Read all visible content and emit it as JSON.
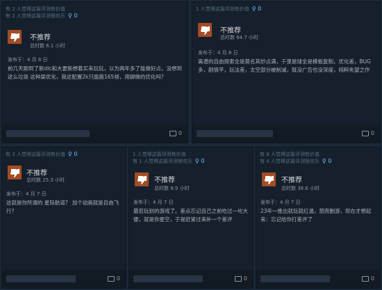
{
  "reviews": [
    {
      "helpful_line1": "有 2 人觉得这篇评测有价值",
      "helpful_line2": "有 2 人觉得这篇评测很欢乐",
      "award_count": "0",
      "verdict": "不推荐",
      "hours": "总时数 6.1 小时",
      "date": "发布于：4 月 8 日",
      "text": "前几天刚到了新dlc和大更新想着买来玩玩，以为两年多了能做好点，没想到这么垃圾 这种屎优化，我这配置2k只能跑165帧，用脚做的优化吗？",
      "comments": "0"
    },
    {
      "helpful_line1": "1 人觉得这篇评测有价值",
      "helpful_line2": "",
      "award_count": "0",
      "verdict": "不推荐",
      "hours": "总时数 64.7 小时",
      "date": "发布于：4 月 8 日",
      "text": "离谱的自由探索全是莫名其妙点满，千里是球全是模板复制，优化差，BUG多，剧情平，玩法差，太空部分被削减，既没广告也没深度，纯粹失望之作",
      "comments": "0"
    },
    {
      "helpful_line1": "有 3 人觉得这篇评测有价值",
      "helpful_line2": "",
      "award_count": "0",
      "verdict": "不推荐",
      "hours": "总时数 25.3 小时",
      "date": "发布于：4 月 7 日",
      "text": "这就是你所谓的 星际航道？ 加个动画就是自由飞行？",
      "comments": "0"
    },
    {
      "helpful_line1": "1 人觉得这篇评测有价值",
      "helpful_line2": "有 1 人觉得这篇评测很欢乐",
      "award_count": "0",
      "verdict": "不推荐",
      "hours": "总时数 8.9 小时",
      "date": "发布于：4 月 7 日",
      "text": "最若玩别的游戏了。差点忘记自己之前吃过一坨大便，就是你星空，于是赶紧过来补一个差评",
      "comments": "0"
    },
    {
      "helpful_line1": "有 8 人觉得这篇评测有价值",
      "helpful_line2": "有 4 人觉得这篇评测很欢乐",
      "award_count": "0",
      "verdict": "不推荐",
      "hours": "总时数 38.6 小时",
      "date": "发布于：4 月 7 日",
      "text": "23年一推出就玩就红温，怒而删游，现在才想起来：忘记给你打差评了",
      "comments": "0"
    }
  ],
  "colors": {
    "background": "#1b2838",
    "card": "#16202d",
    "thumb_down": "#a34c25",
    "award": "#66c0f4"
  }
}
